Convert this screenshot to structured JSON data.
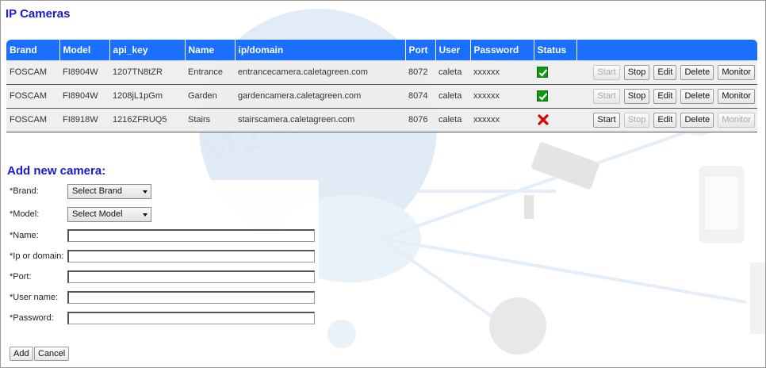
{
  "page": {
    "title": "IP Cameras"
  },
  "table": {
    "headers": [
      "Brand",
      "Model",
      "api_key",
      "Name",
      "ip/domain",
      "Port",
      "User",
      "Password",
      "Status",
      ""
    ],
    "rows": [
      {
        "brand": "FOSCAM",
        "model": "FI8904W",
        "api_key": "1207TN8tZR",
        "name": "Entrance",
        "ip": "entrancecamera.caletagreen.com",
        "port": "8072",
        "user": "caleta",
        "password": "xxxxxx",
        "status": "ok",
        "buttons": {
          "start": "Start",
          "stop": "Stop",
          "edit": "Edit",
          "delete": "Delete",
          "monitor": "Monitor"
        }
      },
      {
        "brand": "FOSCAM",
        "model": "FI8904W",
        "api_key": "1208jL1pGm",
        "name": "Garden",
        "ip": "gardencamera.caletagreen.com",
        "port": "8074",
        "user": "caleta",
        "password": "xxxxxx",
        "status": "ok",
        "buttons": {
          "start": "Start",
          "stop": "Stop",
          "edit": "Edit",
          "delete": "Delete",
          "monitor": "Monitor"
        }
      },
      {
        "brand": "FOSCAM",
        "model": "FI8918W",
        "api_key": "1216ZFRUQ5",
        "name": "Stairs",
        "ip": "stairscamera.caletagreen.com",
        "port": "8076",
        "user": "caleta",
        "password": "xxxxxx",
        "status": "error",
        "buttons": {
          "start": "Start",
          "stop": "Stop",
          "edit": "Edit",
          "delete": "Delete",
          "monitor": "Monitor"
        }
      }
    ]
  },
  "form": {
    "title": "Add new camera:",
    "brand_label": "*Brand:",
    "brand_value": "Select Brand",
    "model_label": "*Model:",
    "model_value": "Select Model",
    "name_label": "*Name:",
    "ip_label": "*Ip or domain:",
    "port_label": "*Port:",
    "user_label": "*User name:",
    "password_label": "*Password:",
    "add_label": "Add",
    "cancel_label": "Cancel"
  },
  "colors": {
    "header_bg": "#1a6fff",
    "title": "#1a1acc",
    "status_ok": "#0f9a0f",
    "status_error": "#dd0000"
  },
  "icons": {
    "status_ok": "check-icon",
    "status_error": "cross-icon"
  }
}
